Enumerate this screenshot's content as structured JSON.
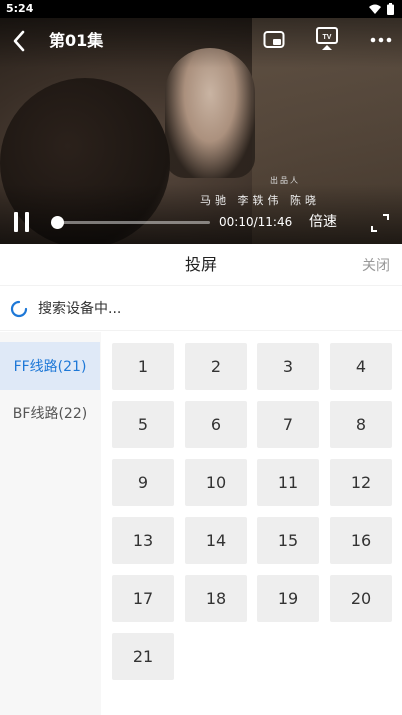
{
  "status_bar": {
    "time": "5:24"
  },
  "player": {
    "episode_title": "第01集",
    "subtitle_top": "出品人",
    "subtitle_names": "马驰  李轶伟  陈晓",
    "time_display": "00:10/11:46",
    "speed_label": "倍速",
    "progress_fraction": 0.014
  },
  "cast_panel": {
    "title": "投屏",
    "close_label": "关闭",
    "search_status": "搜索设备中..."
  },
  "routes": [
    {
      "label": "FF线路(21)",
      "active": true
    },
    {
      "label": "BF线路(22)",
      "active": false
    }
  ],
  "episodes": [
    "1",
    "2",
    "3",
    "4",
    "5",
    "6",
    "7",
    "8",
    "9",
    "10",
    "11",
    "12",
    "13",
    "14",
    "15",
    "16",
    "17",
    "18",
    "19",
    "20",
    "21"
  ],
  "colors": {
    "accent": "#1e78d7",
    "route_active_bg": "#dfe9f7"
  }
}
